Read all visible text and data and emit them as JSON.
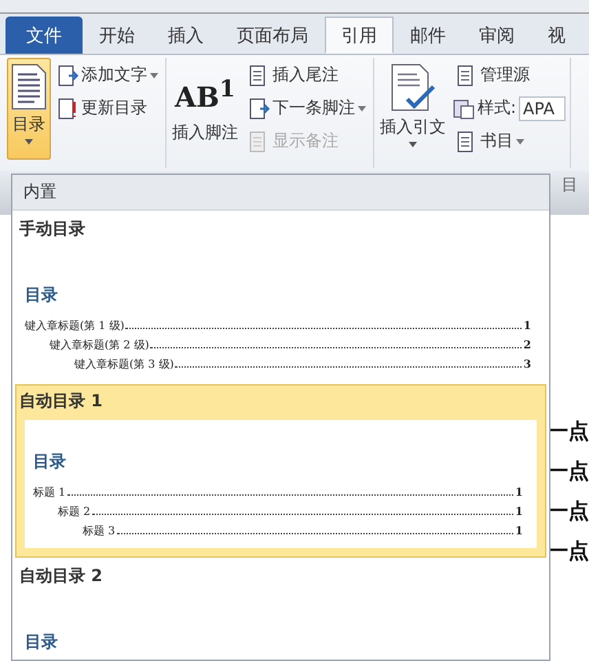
{
  "tabs": [
    {
      "label": "文件",
      "kind": "file",
      "selected": false
    },
    {
      "label": "开始",
      "kind": "tab",
      "selected": false
    },
    {
      "label": "插入",
      "kind": "tab",
      "selected": false
    },
    {
      "label": "页面布局",
      "kind": "tab",
      "selected": false
    },
    {
      "label": "引用",
      "kind": "tab",
      "selected": true
    },
    {
      "label": "邮件",
      "kind": "tab",
      "selected": false
    },
    {
      "label": "审阅",
      "kind": "tab",
      "selected": false
    },
    {
      "label": "视",
      "kind": "tab",
      "selected": false
    }
  ],
  "ribbon": {
    "groups": [
      {
        "large": {
          "label": "目录",
          "caret": true,
          "pressed": true
        },
        "small": [
          {
            "kind": "button",
            "label": "添加文字",
            "caret": true,
            "disabled": false
          },
          {
            "kind": "button",
            "label": "更新目录",
            "caret": false,
            "disabled": false
          }
        ]
      },
      {
        "large": {
          "label": "插入脚注",
          "icon_text": "AB$^{1}$",
          "caret": false,
          "pressed": false
        },
        "small": [
          {
            "kind": "button",
            "label": "插入尾注",
            "caret": false,
            "disabled": false
          },
          {
            "kind": "button",
            "label": "下一条脚注",
            "caret": true,
            "disabled": false
          },
          {
            "kind": "button",
            "label": "显示备注",
            "caret": false,
            "disabled": true
          }
        ]
      },
      {
        "large": {
          "label": "插入引文",
          "caret": true,
          "pressed": false
        },
        "small": [
          {
            "kind": "button",
            "label": "管理源",
            "caret": false,
            "disabled": false
          },
          {
            "kind": "field",
            "label": "样式:",
            "value": "APA"
          },
          {
            "kind": "button",
            "label": "书目",
            "caret": true,
            "disabled": false
          }
        ]
      }
    ]
  },
  "background_document": {
    "group_label": "目",
    "lines": [
      "一点",
      "一点",
      "一点",
      "一点"
    ]
  },
  "toc_gallery": {
    "header": "内置",
    "entries": [
      {
        "title": "手动目录",
        "selected": false,
        "preview": {
          "heading": "目录",
          "lines": [
            {
              "text": "键入章标题(第 1 级)",
              "page": "1",
              "children": [
                {
                  "text": "键入章标题(第 2 级)",
                  "page": "2",
                  "children": [
                    {
                      "text": "键入章标题(第 3 级)",
                      "page": "3"
                    }
                  ]
                }
              ]
            }
          ]
        }
      },
      {
        "title": "自动目录 1",
        "selected": true,
        "preview": {
          "heading": "目录",
          "lines": [
            {
              "text": "标题 1",
              "page": "1",
              "children": [
                {
                  "text": "标题 2",
                  "page": "1",
                  "children": [
                    {
                      "text": "标题 3",
                      "page": "1"
                    }
                  ]
                }
              ]
            }
          ]
        }
      },
      {
        "title": "自动目录 2",
        "selected": false,
        "preview": {
          "heading": "目录"
        }
      }
    ]
  }
}
